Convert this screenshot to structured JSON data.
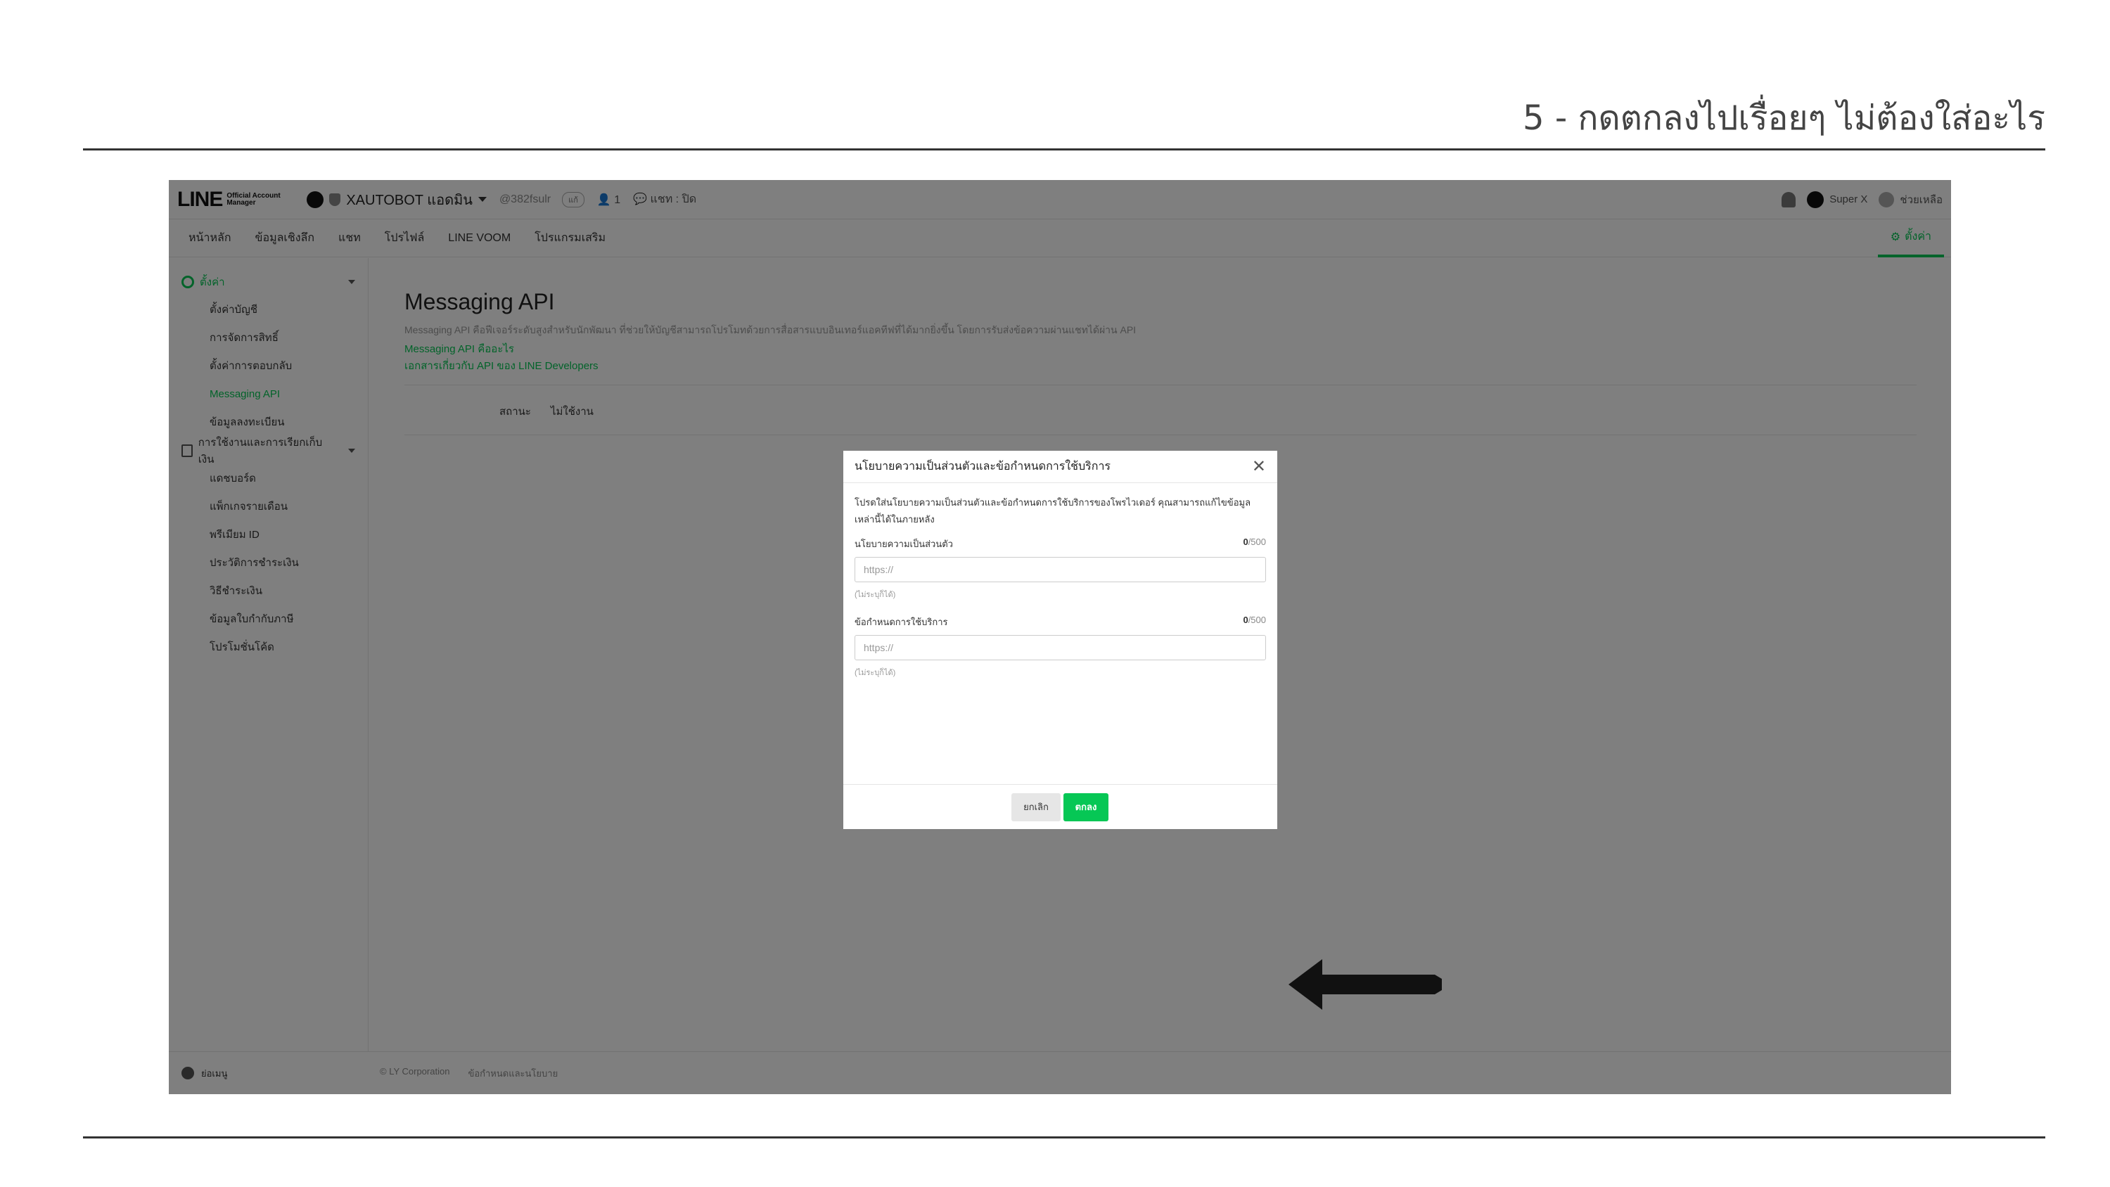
{
  "slide": {
    "title": "5 - กดตกลงไปเรื่อยๆ ไม่ต้องใส่อะไร"
  },
  "app": {
    "logo_text": "LINE",
    "logo_sub": "Official Account Manager",
    "account_name": "XAUTOBOT แอดมิน",
    "account_id": "@382fsulr",
    "badge": "แก้",
    "followers": "1",
    "chat_status": "แชท : ปิด",
    "user_name": "Super X",
    "help": "ช่วยเหลือ"
  },
  "nav": {
    "items": [
      "หน้าหลัก",
      "ข้อมูลเชิงลึก",
      "แชท",
      "โปรไฟล์",
      "LINE VOOM",
      "โปรแกรมเสริม"
    ],
    "settings": "ตั้งค่า"
  },
  "sidebar": {
    "group1": "ตั้งค่า",
    "group1_items": [
      "ตั้งค่าบัญชี",
      "การจัดการสิทธิ์",
      "ตั้งค่าการตอบกลับ",
      "Messaging API",
      "ข้อมูลลงทะเบียน"
    ],
    "group2": "การใช้งานและการเรียกเก็บเงิน",
    "group2_items": [
      "แดชบอร์ด",
      "แพ็กเกจรายเดือน",
      "พรีเมียม ID",
      "ประวัติการชำระเงิน",
      "วิธีชำระเงิน",
      "ข้อมูลใบกำกับภาษี",
      "โปรโมชั่นโค้ด"
    ]
  },
  "main": {
    "title": "Messaging API",
    "description": "Messaging API คือฟีเจอร์ระดับสูงสำหรับนักพัฒนา ที่ช่วยให้บัญชีสามารถโปรโมทด้วยการสื่อสารแบบอินเทอร์แอคทีฟที่ได้มากยิ่งขึ้น โดยการรับส่งข้อความผ่านแชทได้ผ่าน API",
    "link1": "Messaging API คืออะไร",
    "link2": "เอกสารเกี่ยวกับ API ของ LINE Developers",
    "status_label": "สถานะ",
    "status_value": "ไม่ใช้งาน"
  },
  "footer": {
    "menu": "ย่อเมนู",
    "copyright": "© LY Corporation",
    "terms": "ข้อกำหนดและนโยบาย"
  },
  "modal": {
    "title": "นโยบายความเป็นส่วนตัวและข้อกำหนดการใช้บริการ",
    "description": "โปรดใส่นโยบายความเป็นส่วนตัวและข้อกำหนดการใช้บริการของโพรไวเดอร์ คุณสามารถแก้ไขข้อมูลเหล่านี้ได้ในภายหลัง",
    "field1_label": "นโยบายความเป็นส่วนตัว",
    "field1_count": "0",
    "field1_max": "/500",
    "field1_placeholder": "https://",
    "field1_hint": "(ไม่ระบุก็ได้)",
    "field2_label": "ข้อกำหนดการใช้บริการ",
    "field2_count": "0",
    "field2_max": "/500",
    "field2_placeholder": "https://",
    "field2_hint": "(ไม่ระบุก็ได้)",
    "cancel_label": "ยกเลิก",
    "ok_label": "ตกลง"
  },
  "colors": {
    "brand_green": "#06c755",
    "overlay": "rgba(0,0,0,0.5)"
  }
}
